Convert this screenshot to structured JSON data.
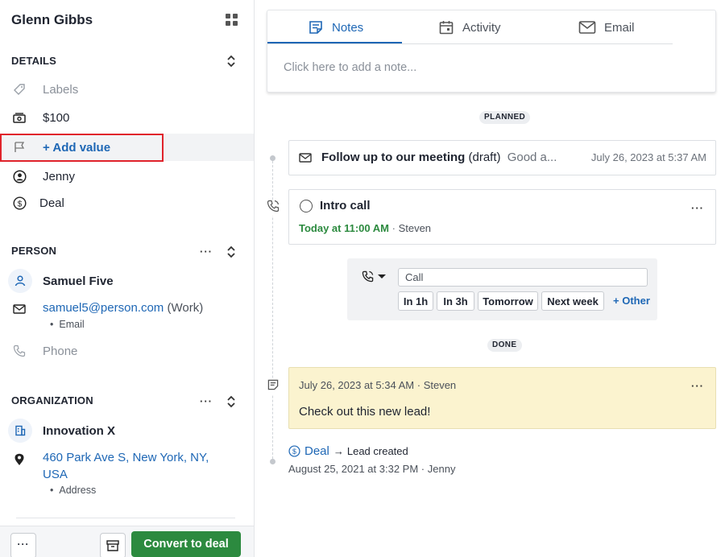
{
  "sidebar": {
    "title": "Glenn Gibbs",
    "details": {
      "heading": "DETAILS",
      "labels_placeholder": "Labels",
      "value": "$100",
      "add_value": "+ Add value",
      "owner": "Jenny",
      "pipeline": "Deal"
    },
    "person": {
      "heading": "PERSON",
      "more": "···",
      "name": "Samuel Five",
      "email": "samuel5@person.com",
      "email_type": "(Work)",
      "email_label": "Email",
      "phone_placeholder": "Phone"
    },
    "organization": {
      "heading": "ORGANIZATION",
      "more": "···",
      "name": "Innovation X",
      "address": "460 Park Ave S, New York, NY, USA",
      "address_label": "Address"
    },
    "footer": {
      "more": "···",
      "convert_label": "Convert to deal"
    }
  },
  "composer": {
    "tabs": [
      {
        "label": "Notes",
        "active": true
      },
      {
        "label": "Activity",
        "active": false
      },
      {
        "label": "Email",
        "active": false
      }
    ],
    "placeholder": "Click here to add a note..."
  },
  "timeline": {
    "planned_label": "PLANNED",
    "done_label": "DONE",
    "email_item": {
      "subject": "Follow up to our meeting",
      "status": "(draft)",
      "preview": "Good a...",
      "date": "July 26, 2023 at 5:37 AM"
    },
    "call_item": {
      "title": "Intro call",
      "due": "Today at 11:00 AM",
      "assignee": "Steven",
      "more": "···"
    },
    "quick_add": {
      "subject_value": "Call",
      "buttons": [
        "In 1h",
        "In 3h",
        "Tomorrow",
        "Next week"
      ],
      "other_link": "+ Other"
    },
    "note_item": {
      "date": "July 26, 2023 at 5:34 AM",
      "author": "Steven",
      "text": "Check out this new lead!",
      "more": "···"
    },
    "created_item": {
      "link": "Deal",
      "arrow": "→",
      "text": "Lead created",
      "date": "August 25, 2021 at 3:32 PM",
      "author": "Jenny"
    }
  },
  "colors": {
    "accent": "#1e67b5",
    "convert_green": "#2c8a3f",
    "due_green": "#2c8a3f",
    "note_bg": "#fbf3cf",
    "highlight_red": "#e0232b"
  }
}
